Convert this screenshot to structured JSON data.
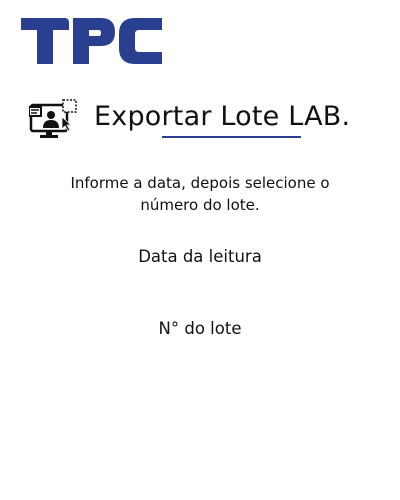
{
  "logo": {
    "text": "TPC",
    "icon": "tpc-logo",
    "color": "#2a3f8f"
  },
  "header": {
    "icon": "monitor-user-export-icon",
    "title": "Exportar Lote LAB.",
    "accent_color": "#2a3f8f"
  },
  "main": {
    "instructions": "Informe a data, depois selecione o número do lote.",
    "date_label": "Data da leitura",
    "lot_label": "N° do lote"
  }
}
